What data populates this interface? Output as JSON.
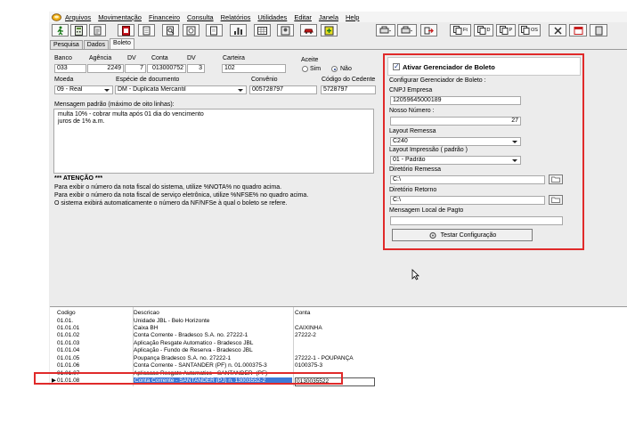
{
  "menu": {
    "items": [
      "Arquivos",
      "Movimentação",
      "Financeiro",
      "Consulta",
      "Relatórios",
      "Utilidades",
      "Editar",
      "Janela",
      "Help"
    ]
  },
  "toolbar": {
    "btn_ft": "Ft",
    "btn_d": "D",
    "btn_p": "P",
    "btn_os": "OS"
  },
  "tabs": [
    "Pesquisa",
    "Dados",
    "Boleto"
  ],
  "form": {
    "banco_label": "Banco",
    "banco": "033",
    "agencia_label": "Agência",
    "agencia": "2249",
    "dv1_label": "DV",
    "dv1": "7",
    "conta_label": "Conta",
    "conta": "013000752",
    "dv2_label": "DV",
    "dv2": "3",
    "carteira_label": "Carteira",
    "carteira": "102",
    "aceite_label": "Aceite",
    "aceite_sim": "Sim",
    "aceite_nao": "Não",
    "moeda_label": "Moeda",
    "moeda": "09 - Real",
    "especie_label": "Espécie de documento",
    "especie": "DM - Duplicata Mercantil",
    "convenio_label": "Convênio",
    "convenio": "005728797",
    "cedente_label": "Código do Cedente",
    "cedente": "5728797",
    "mensagem_label": "Mensagem padrão (máximo de oito linhas):",
    "mensagem_1": "multa 10% - cobrar multa após 01 dia do vencimento",
    "mensagem_2": "juros de 1% a.m.",
    "atencao_title": "*** ATENÇÃO ***",
    "atencao_1": "Para exibir o número da nota fiscal do sistema, utilize %NOTA% no quadro acima.",
    "atencao_2": "Para exibir o número da nota fiscal de serviço eletrônica, utilize %NFSE% no quadro acima.",
    "atencao_3": "O sistema exibirá automaticamente o número da NF/NFSe à qual o boleto se refere."
  },
  "panel": {
    "ativar_label": "Ativar Gerenciador de Boleto",
    "config_label": "Configurar Gerenciador de Boleto :",
    "cnpj_label": "CNPJ Empresa",
    "cnpj": "12059645000189",
    "nosso_label": "Nosso Número :",
    "nosso": "27",
    "layout_rem_label": "Layout Remessa",
    "layout_rem": "C240",
    "layout_imp_label": "Layout Impressão ( padrão )",
    "layout_imp": "01 - Padrão",
    "dir_rem_label": "Diretório Remessa",
    "dir_rem": "C:\\",
    "dir_ret_label": "Diretório Retorno",
    "dir_ret": "C:\\",
    "msg_local_label": "Mensagem Local de Pagto",
    "msg_local": "",
    "testar_label": "Testar Configuração"
  },
  "grid": {
    "headers": [
      "Codigo",
      "Descricao",
      "Conta"
    ],
    "rows": [
      [
        "01.01.",
        "Unidade JBL - Belo Horizonte",
        ""
      ],
      [
        "01.01.01",
        "Caixa BH",
        "CAIXINHA"
      ],
      [
        "01.01.02",
        "Conta Corrente - Bradesco S.A. no. 27222-1",
        "27222-2"
      ],
      [
        "01.01.03",
        "Aplicação Resgate Automatico - Bradesco JBL",
        ""
      ],
      [
        "01.01.04",
        "Aplicação - Fundo de Reserva - Bradesco JBL",
        ""
      ],
      [
        "01.01.05",
        "Poupança Bradesco S.A. no. 27222-1",
        "27222-1 - POUPANÇA"
      ],
      [
        "01.01.06",
        "Conta Corrente - SANTANDER (PF) n. 01.000375-3",
        "0100375-3"
      ],
      [
        "01.01.07",
        "Aplicacao Resgate Automatico - SANTANDER -(PF)",
        ""
      ],
      [
        "01.01.08",
        "Conta Corrente - SANTANDER (PJ) n. 13003552-2",
        "0130035522"
      ]
    ]
  },
  "colors": {
    "highlight": "#e02a2a",
    "selection": "#3d7ad8"
  }
}
